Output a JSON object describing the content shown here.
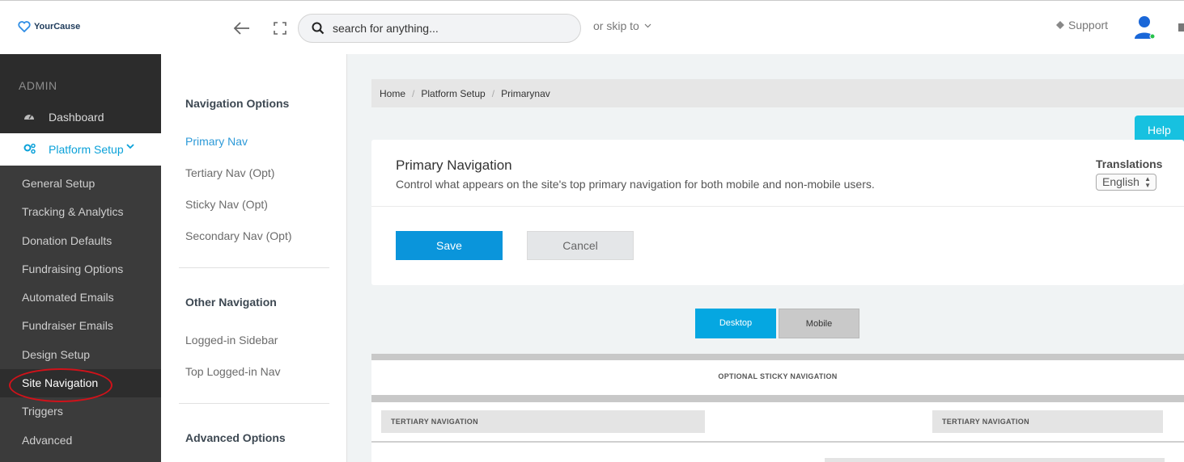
{
  "header": {
    "logo_text": "YourCause",
    "search_placeholder": "search for anything...",
    "skip_to": "or skip to",
    "support": "Support"
  },
  "sidebar": {
    "section_label": "ADMIN",
    "dashboard": "Dashboard",
    "platform_setup": "Platform Setup",
    "items": [
      {
        "label": "General Setup"
      },
      {
        "label": "Tracking & Analytics"
      },
      {
        "label": "Donation Defaults"
      },
      {
        "label": "Fundraising Options"
      },
      {
        "label": "Automated Emails"
      },
      {
        "label": "Fundraiser Emails"
      },
      {
        "label": "Design Setup"
      },
      {
        "label": "Site Navigation"
      },
      {
        "label": "Triggers"
      },
      {
        "label": "Advanced"
      }
    ]
  },
  "subnav": {
    "nav_options_heading": "Navigation Options",
    "primary_nav": "Primary Nav",
    "tertiary_nav": "Tertiary Nav (Opt)",
    "sticky_nav": "Sticky Nav (Opt)",
    "secondary_nav": "Secondary Nav (Opt)",
    "other_nav_heading": "Other Navigation",
    "logged_in_sidebar": "Logged-in Sidebar",
    "top_logged_in_nav": "Top Logged-in Nav",
    "advanced_heading": "Advanced Options"
  },
  "breadcrumb": {
    "home": "Home",
    "platform_setup": "Platform Setup",
    "current": "Primarynav"
  },
  "help_label": "Help",
  "card": {
    "title": "Primary Navigation",
    "subtitle": "Control what appears on the site's top primary navigation for both mobile and non-mobile users.",
    "translations_label": "Translations",
    "language": "English",
    "save_label": "Save",
    "cancel_label": "Cancel"
  },
  "view_tabs": {
    "desktop": "Desktop",
    "mobile": "Mobile"
  },
  "preview": {
    "sticky_label": "OPTIONAL STICKY NAVIGATION",
    "tertiary_left": "TERTIARY NAVIGATION",
    "tertiary_right": "TERTIARY NAVIGATION"
  },
  "colors": {
    "accent": "#0a95db",
    "tab_active": "#05a7e1",
    "help": "#17c1e0",
    "sidebar_bg": "#3b3b3b",
    "highlight_ring": "#d0121a"
  }
}
